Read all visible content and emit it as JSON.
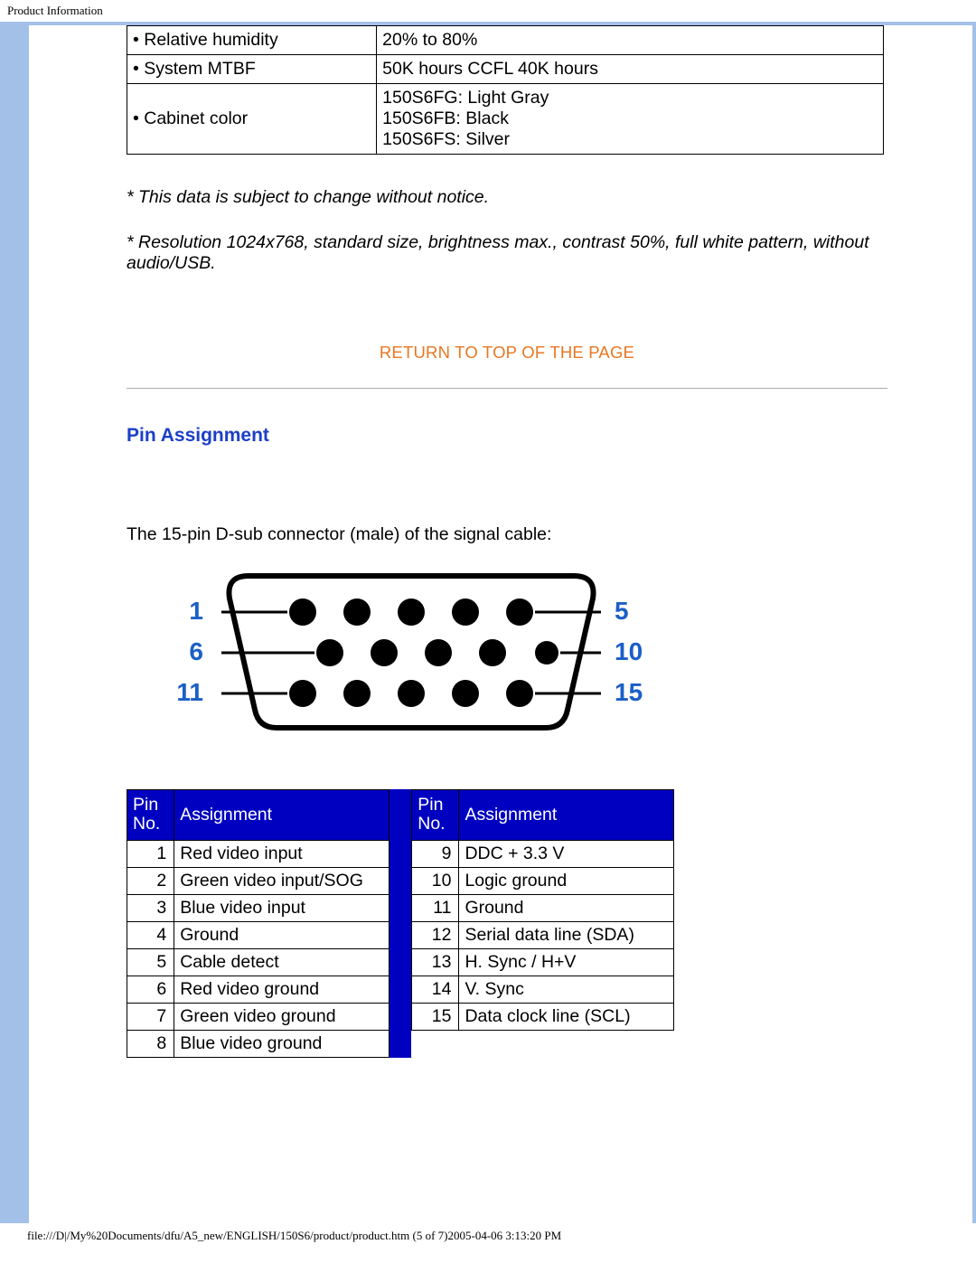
{
  "header": {
    "title": "Product Information"
  },
  "spec_table": {
    "rows": [
      {
        "label": "Relative humidity",
        "value": "20% to 80%"
      },
      {
        "label": "System MTBF",
        "value": "50K hours CCFL 40K hours"
      },
      {
        "label": "Cabinet color",
        "value": "150S6FG: Light Gray\n150S6FB: Black\n150S6FS: Silver"
      }
    ]
  },
  "notes": {
    "line1": "* This data is subject to change without notice.",
    "line2": "* Resolution 1024x768, standard size, brightness max., contrast 50%, full white pattern, without audio/USB."
  },
  "back_top": "RETURN TO TOP OF THE PAGE",
  "section": {
    "title": "Pin Assignment",
    "desc": "The 15-pin D-sub connector (male) of the signal cable:"
  },
  "connector": {
    "labels": {
      "l1": "1",
      "l6": "6",
      "l11": "11",
      "r5": "5",
      "r10": "10",
      "r15": "15"
    }
  },
  "pins": {
    "head_num": "Pin\nNo.",
    "head_assign": "Assignment",
    "left": [
      {
        "n": "1",
        "a": "Red video input"
      },
      {
        "n": "2",
        "a": "Green video input/SOG"
      },
      {
        "n": "3",
        "a": "Blue video input"
      },
      {
        "n": "4",
        "a": "Ground"
      },
      {
        "n": "5",
        "a": "Cable detect"
      },
      {
        "n": "6",
        "a": "Red video ground"
      },
      {
        "n": "7",
        "a": "Green video ground"
      },
      {
        "n": "8",
        "a": "Blue video ground"
      }
    ],
    "right": [
      {
        "n": "9",
        "a": "DDC + 3.3 V"
      },
      {
        "n": "10",
        "a": "Logic ground"
      },
      {
        "n": "11",
        "a": "Ground"
      },
      {
        "n": "12",
        "a": "Serial data line (SDA)"
      },
      {
        "n": "13",
        "a": "H. Sync / H+V"
      },
      {
        "n": "14",
        "a": "V. Sync"
      },
      {
        "n": "15",
        "a": "Data clock line (SCL)"
      }
    ]
  },
  "footer": {
    "path": "file:///D|/My%20Documents/dfu/A5_new/ENGLISH/150S6/product/product.htm (5 of 7)2005-04-06 3:13:20 PM"
  }
}
